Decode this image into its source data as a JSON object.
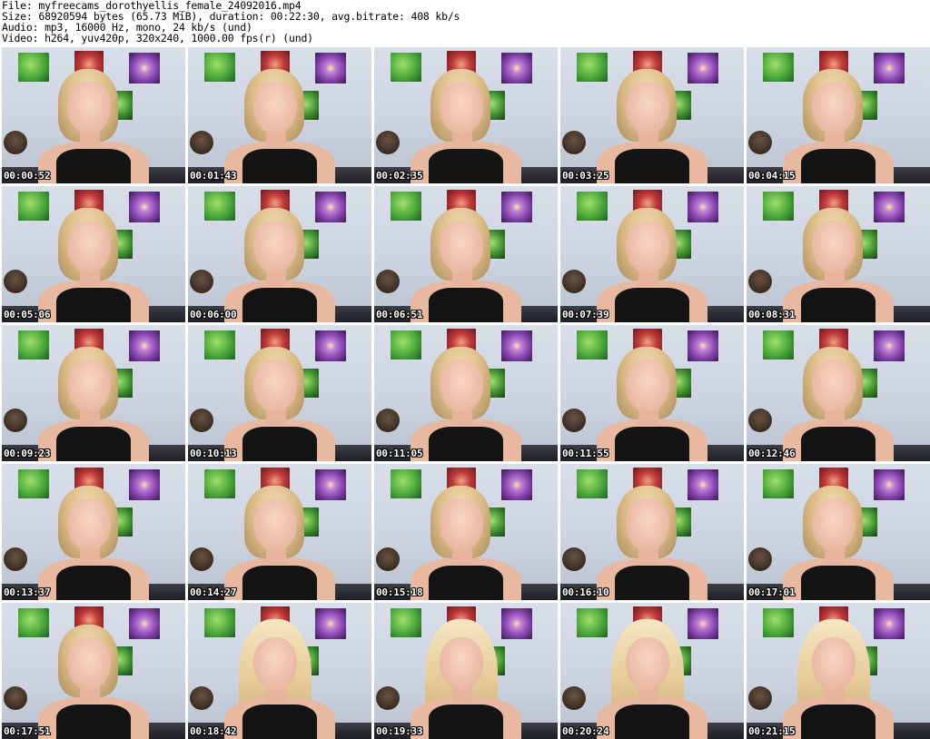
{
  "header": {
    "file": "File: myfreecams_dorothyellis_female_24092016.mp4",
    "size": "Size: 68920594 bytes (65.73 MiB), duration: 00:22:30, avg.bitrate: 408 kb/s",
    "audio": "Audio: mp3, 16000 Hz, mono, 24 kb/s (und)",
    "video": "Video: h264, yuv420p, 320x240, 1000.00 fps(r) (und)"
  },
  "thumbnails": [
    {
      "time": "00:00:52",
      "hair": "bun"
    },
    {
      "time": "00:01:43",
      "hair": "bun"
    },
    {
      "time": "00:02:35",
      "hair": "bun"
    },
    {
      "time": "00:03:25",
      "hair": "bun"
    },
    {
      "time": "00:04:15",
      "hair": "bun"
    },
    {
      "time": "00:05:06",
      "hair": "bun"
    },
    {
      "time": "00:06:00",
      "hair": "bun"
    },
    {
      "time": "00:06:51",
      "hair": "bun"
    },
    {
      "time": "00:07:39",
      "hair": "bun"
    },
    {
      "time": "00:08:31",
      "hair": "bun"
    },
    {
      "time": "00:09:23",
      "hair": "bun"
    },
    {
      "time": "00:10:13",
      "hair": "bun"
    },
    {
      "time": "00:11:05",
      "hair": "bun"
    },
    {
      "time": "00:11:55",
      "hair": "bun"
    },
    {
      "time": "00:12:46",
      "hair": "bun"
    },
    {
      "time": "00:13:37",
      "hair": "bun"
    },
    {
      "time": "00:14:27",
      "hair": "bun"
    },
    {
      "time": "00:15:18",
      "hair": "bun"
    },
    {
      "time": "00:16:10",
      "hair": "bun"
    },
    {
      "time": "00:17:01",
      "hair": "bun"
    },
    {
      "time": "00:17:51",
      "hair": "bun"
    },
    {
      "time": "00:18:42",
      "hair": "long"
    },
    {
      "time": "00:19:33",
      "hair": "long"
    },
    {
      "time": "00:20:24",
      "hair": "long"
    },
    {
      "time": "00:21:15",
      "hair": "long"
    }
  ]
}
